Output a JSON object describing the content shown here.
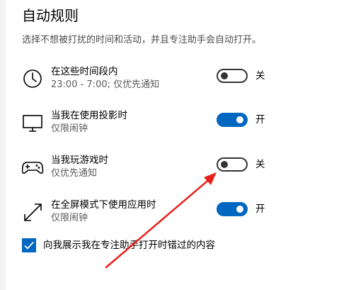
{
  "title": "自动规则",
  "description": "选择不想被打扰的时间和活动，并且专注助手会自动打开。",
  "rules": [
    {
      "icon": "clock-icon",
      "title": "在这些时间段内",
      "subtitle": "23:00 - 7:00; 仅优先通知",
      "state": "off",
      "state_label": "关"
    },
    {
      "icon": "monitor-icon",
      "title": "当我在使用投影时",
      "subtitle": "仅限闹钟",
      "state": "on",
      "state_label": "开"
    },
    {
      "icon": "gamepad-icon",
      "title": "当我玩游戏时",
      "subtitle": "仅优先通知",
      "state": "off",
      "state_label": "关"
    },
    {
      "icon": "fullscreen-icon",
      "title": "在全屏模式下使用应用时",
      "subtitle": "仅限闹钟",
      "state": "on",
      "state_label": "开"
    }
  ],
  "show_missed_checkbox": {
    "checked": true,
    "label": "向我展示我在专注助手打开时错过的内容"
  },
  "colors": {
    "accent": "#0067c0",
    "annotation_arrow": "#e8201c",
    "toggle_off": "#333333"
  }
}
